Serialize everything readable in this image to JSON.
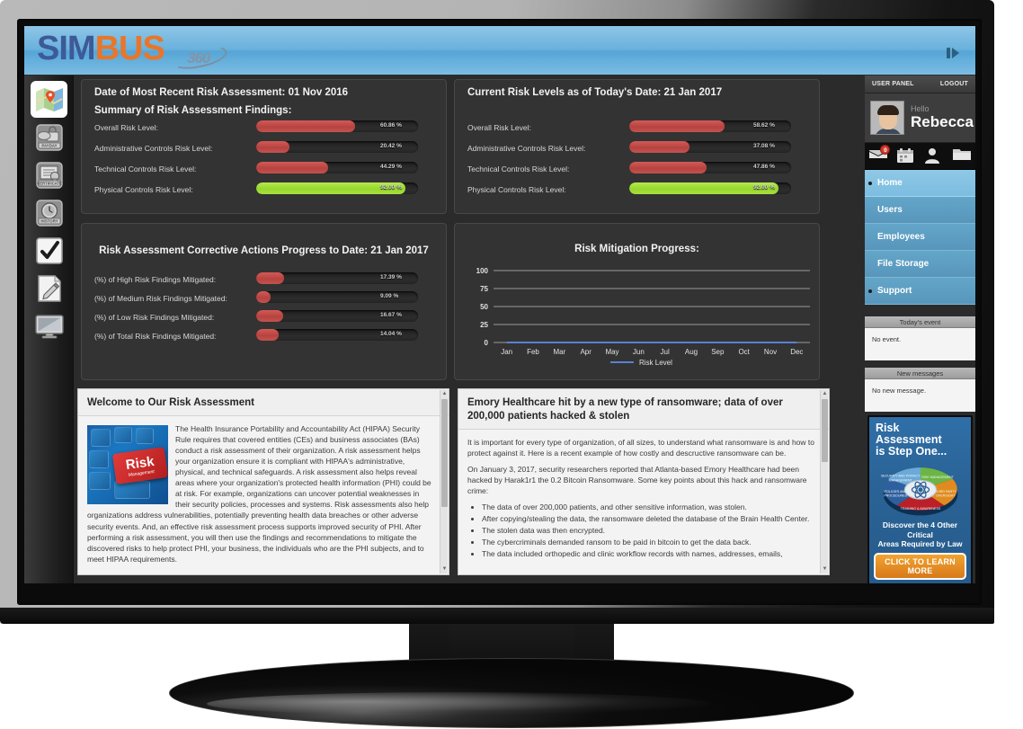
{
  "app": {
    "logo_sim": "SIM",
    "logo_bus": "BUS",
    "logo_360": "360",
    "panel_toggle_icon": "collapse-panel-icon"
  },
  "rail": {
    "items": [
      {
        "name": "map-icon",
        "label": "Map"
      },
      {
        "name": "payday-lock-icon",
        "label": "PAYDAY"
      },
      {
        "name": "certificate-icon",
        "label": "CERTIFICATE"
      },
      {
        "name": "history-timer-icon",
        "label": "HISTORY"
      },
      {
        "name": "checkmark-icon",
        "label": "Checklist"
      },
      {
        "name": "pencil-edit-icon",
        "label": "Edit"
      },
      {
        "name": "monitor-icon",
        "label": "Monitor"
      }
    ]
  },
  "summary_card": {
    "date_title": "Date of Most Recent Risk Assessment: 01 Nov 2016",
    "subtitle": "Summary of Risk Assessment Findings:",
    "bars": [
      {
        "label": "Overall Risk Level:",
        "value": 60.86,
        "display": "60.86 %",
        "color": "red"
      },
      {
        "label": "Administrative Controls Risk Level:",
        "value": 20.42,
        "display": "20.42 %",
        "color": "red"
      },
      {
        "label": "Technical Controls Risk Level:",
        "value": 44.29,
        "display": "44.29 %",
        "color": "red"
      },
      {
        "label": "Physical Controls Risk Level:",
        "value": 92.0,
        "display": "92.00 %",
        "color": "green"
      }
    ]
  },
  "current_card": {
    "title": "Current Risk Levels as of Today's Date: 21 Jan 2017",
    "bars": [
      {
        "label": "Overall Risk Level:",
        "value": 58.62,
        "display": "58.62 %",
        "color": "red"
      },
      {
        "label": "Administrative Controls Risk Level:",
        "value": 37.08,
        "display": "37.08 %",
        "color": "red"
      },
      {
        "label": "Technical Controls Risk Level:",
        "value": 47.86,
        "display": "47.86 %",
        "color": "red"
      },
      {
        "label": "Physical Controls Risk Level:",
        "value": 92.0,
        "display": "92.00 %",
        "color": "green"
      }
    ]
  },
  "corrective_card": {
    "title": "Risk Assessment Corrective Actions Progress to Date: 21 Jan 2017",
    "bars": [
      {
        "label": "(%) of High Risk Findings Mitigated:",
        "value": 17.39,
        "display": "17.39 %",
        "color": "red"
      },
      {
        "label": "(%) of Medium Risk Findings Mitigated:",
        "value": 9.09,
        "display": "9.09 %",
        "color": "red"
      },
      {
        "label": "(%) of Low Risk Findings Mitigated:",
        "value": 16.67,
        "display": "16.67 %",
        "color": "red"
      },
      {
        "label": "(%) of Total Risk Findings Mitigated:",
        "value": 14.04,
        "display": "14.04 %",
        "color": "red"
      }
    ]
  },
  "chart_data": {
    "type": "line",
    "title": "Risk Mitigation Progress:",
    "categories": [
      "Jan",
      "Feb",
      "Mar",
      "Apr",
      "May",
      "Jun",
      "Jul",
      "Aug",
      "Sep",
      "Oct",
      "Nov",
      "Dec"
    ],
    "series": [
      {
        "name": "Risk Level",
        "values": [
          0,
          0,
          0,
          0,
          0,
          0,
          0,
          0,
          0,
          0,
          0,
          0
        ],
        "color": "#5b7fd4"
      }
    ],
    "yticks": [
      0,
      25,
      50,
      75,
      100
    ],
    "ylim": [
      0,
      100
    ],
    "xlabel": "",
    "ylabel": "",
    "grid": true,
    "legend_position": "bottom",
    "legend": [
      "Risk Level"
    ]
  },
  "welcome_panel": {
    "title": "Welcome to Our Risk Assessment",
    "image_name": "risk-management-keyboard-image",
    "image_text": "Risk",
    "image_subtext": "Management",
    "body": "The Health Insurance Portability and Accountability Act (HIPAA) Security Rule requires that covered entities (CEs) and business associates (BAs) conduct a risk assessment of their organization. A risk assessment helps your organization ensure it is compliant with HIPAA's administrative, physical, and technical safeguards. A risk assessment also helps reveal areas where your organization's protected health information (PHI) could be at risk. For example, organizations can uncover potential weaknesses in their security policies, processes and systems.  Risk assessments also help organizations address vulnerabilities, potentially preventing health data breaches or other adverse security events. And, an effective risk assessment process supports improved security of PHI. After performing a risk assessment, you will then use the findings and recommendations to mitigate the discovered risks to help protect PHI, your business, the individuals who are the PHI subjects, and to meet HIPAA requirements."
  },
  "news_panel": {
    "title": "Emory Healthcare hit by a new type of ransomware; data of over 200,000 patients hacked & stolen",
    "para1": "It is important for every type of organization, of all sizes, to understand what ransomware is and how to protect against it. Here is a recent example of how costly and descructive ransomware can be.",
    "para2": "On January 3, 2017, security researchers reported that Atlanta-based Emory Healthcare had been hacked by Harak1r1 the 0.2 Bitcoin Ransomware. Some key points about this hack and ransomware crime:",
    "bullets": [
      "The data of over 200,000 patients, and other sensitive information, was stolen.",
      "After copying/stealing the data, the ransomware deleted the database of the Brain Health Center.",
      "The stolen data was then encrypted.",
      "The cybercriminals demanded ransom to be paid in bitcoin to get the data back.",
      "The data included orthopedic and clinic workflow records with names, addresses, emails,"
    ]
  },
  "user_panel": {
    "header_label": "USER PANEL",
    "logout_label": "LOGOUT",
    "greeting": "Hello",
    "username": "Rebecca",
    "quick_icons": [
      {
        "name": "mail-icon",
        "badge": "0"
      },
      {
        "name": "calendar-icon",
        "badge": ""
      },
      {
        "name": "user-icon",
        "badge": ""
      },
      {
        "name": "folder-icon",
        "badge": ""
      }
    ],
    "nav": [
      {
        "label": "Home",
        "active": true
      },
      {
        "label": "Users",
        "active": false
      },
      {
        "label": "Employees",
        "active": false
      },
      {
        "label": "File Storage",
        "active": false
      },
      {
        "label": "Support",
        "active": false
      }
    ],
    "event_section_title": "Today's event",
    "event_text": "No event.",
    "messages_section_title": "New messages",
    "messages_text": "No new message."
  },
  "ad": {
    "headline_line1": "Risk Assessment",
    "headline_line2": "is Step One...",
    "slices": [
      {
        "label": "SECURITY AND PRIVACY MANAGEMENT",
        "color": "#6aa9d8"
      },
      {
        "label": "RISK MANAGEMENT",
        "color": "#6cb544"
      },
      {
        "label": "THIRD PARTY OVERSIGHT",
        "color": "#e08b1e"
      },
      {
        "label": "TRAINING & AWARENESS",
        "color": "#bb2028"
      },
      {
        "label": "POLICIES AND PROCEDURES",
        "color": "#2e5f9e"
      }
    ],
    "sub_line1": "Discover the 4 Other Critical",
    "sub_line2": "Areas Required by Law",
    "button_label": "CLICK TO LEARN MORE"
  },
  "colors": {
    "accent_blue": "#56a5d6",
    "nav_blue": "#6fb2d8",
    "risk_red": "#c25350",
    "risk_green": "#a8e03c"
  }
}
